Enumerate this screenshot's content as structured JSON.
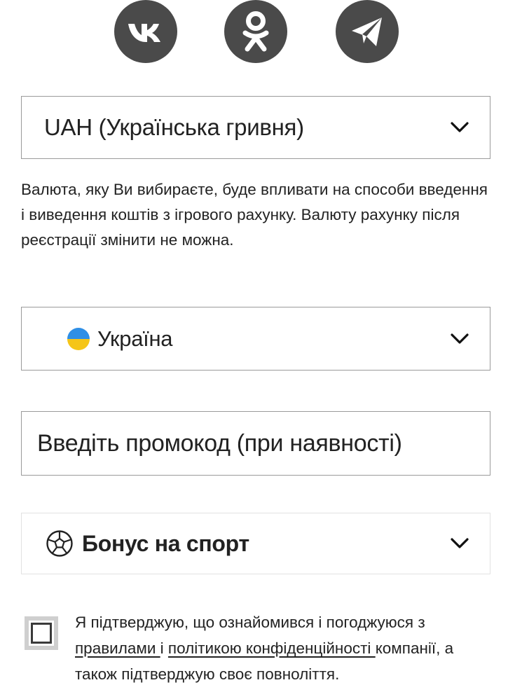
{
  "social": [
    {
      "name": "vk",
      "icon": "vk-icon"
    },
    {
      "name": "odnoklassniki",
      "icon": "odnoklassniki-icon"
    },
    {
      "name": "telegram",
      "icon": "telegram-icon"
    }
  ],
  "currency": {
    "selected": "UAH (Українська гривня)",
    "note": "Валюта, яку Ви вибираєте, буде впливати на способи введення і виведення коштів з ігрового рахунку. Валюту рахунку після реєстрації змінити не можна."
  },
  "country": {
    "selected": "Україна",
    "flag_colors": {
      "top": "#2f8fe6",
      "bottom": "#f5c518"
    }
  },
  "promo": {
    "placeholder": "Введіть промокод (при наявності)"
  },
  "bonus": {
    "selected": "Бонус на спорт",
    "icon": "soccer-ball-icon"
  },
  "consent": {
    "checked": false,
    "text_before": "Я підтверджую, що ознайомився і погоджуюся з ",
    "link_rules": "правилами ",
    "text_and": "і ",
    "link_policy": "політикою конфіденційності ",
    "text_after": "компанії, а також підтверджую своє повноліття."
  }
}
